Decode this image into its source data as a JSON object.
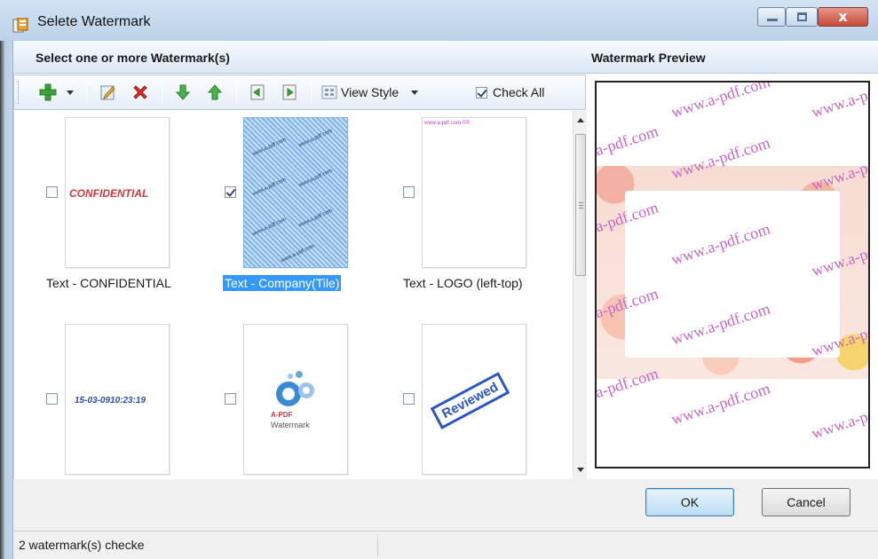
{
  "window": {
    "title": "Selete Watermark",
    "close_glyph": "x"
  },
  "left_panel": {
    "heading": "Select one or more Watermark(s)"
  },
  "right_panel": {
    "heading": "Watermark Preview",
    "preview_text": "www.a-pdf.com"
  },
  "toolbar": {
    "view_style_label": "View Style",
    "check_all_label": "Check All",
    "check_all_checked": true,
    "icons": [
      "add-icon",
      "dropdown-arrow-icon",
      "edit-icon",
      "delete-icon",
      "move-down-icon",
      "move-up-icon",
      "import-icon",
      "export-icon",
      "view-style-icon"
    ]
  },
  "watermarks": [
    {
      "caption": "Text - CONFIDENTIAL",
      "checked": false,
      "selected": false,
      "thumb_text": "CONFIDENTIAL"
    },
    {
      "caption": "Text - Company(Tile)",
      "checked": true,
      "selected": true,
      "thumb_text": "www.a-pdf.com"
    },
    {
      "caption": "Text - LOGO (left-top)",
      "checked": false,
      "selected": false,
      "thumb_text": "www.a-pdf.com ©®"
    },
    {
      "caption": "",
      "checked": false,
      "selected": false,
      "thumb_text": "15-03-0910:23:19"
    },
    {
      "caption": "",
      "checked": false,
      "selected": false,
      "thumb_text": "A-PDF",
      "thumb_subtext": "Watermark"
    },
    {
      "caption": "",
      "checked": false,
      "selected": false,
      "thumb_text": "Reviewed"
    }
  ],
  "buttons": {
    "ok": "OK",
    "cancel": "Cancel"
  },
  "status": {
    "text": "2 watermark(s) checke"
  },
  "colors": {
    "selection": "#3399ff",
    "watermark_pink": "#c768c6",
    "confidential_red": "#d0383a",
    "date_blue": "#2b4fb0",
    "stamp_blue": "#2d56c4"
  }
}
